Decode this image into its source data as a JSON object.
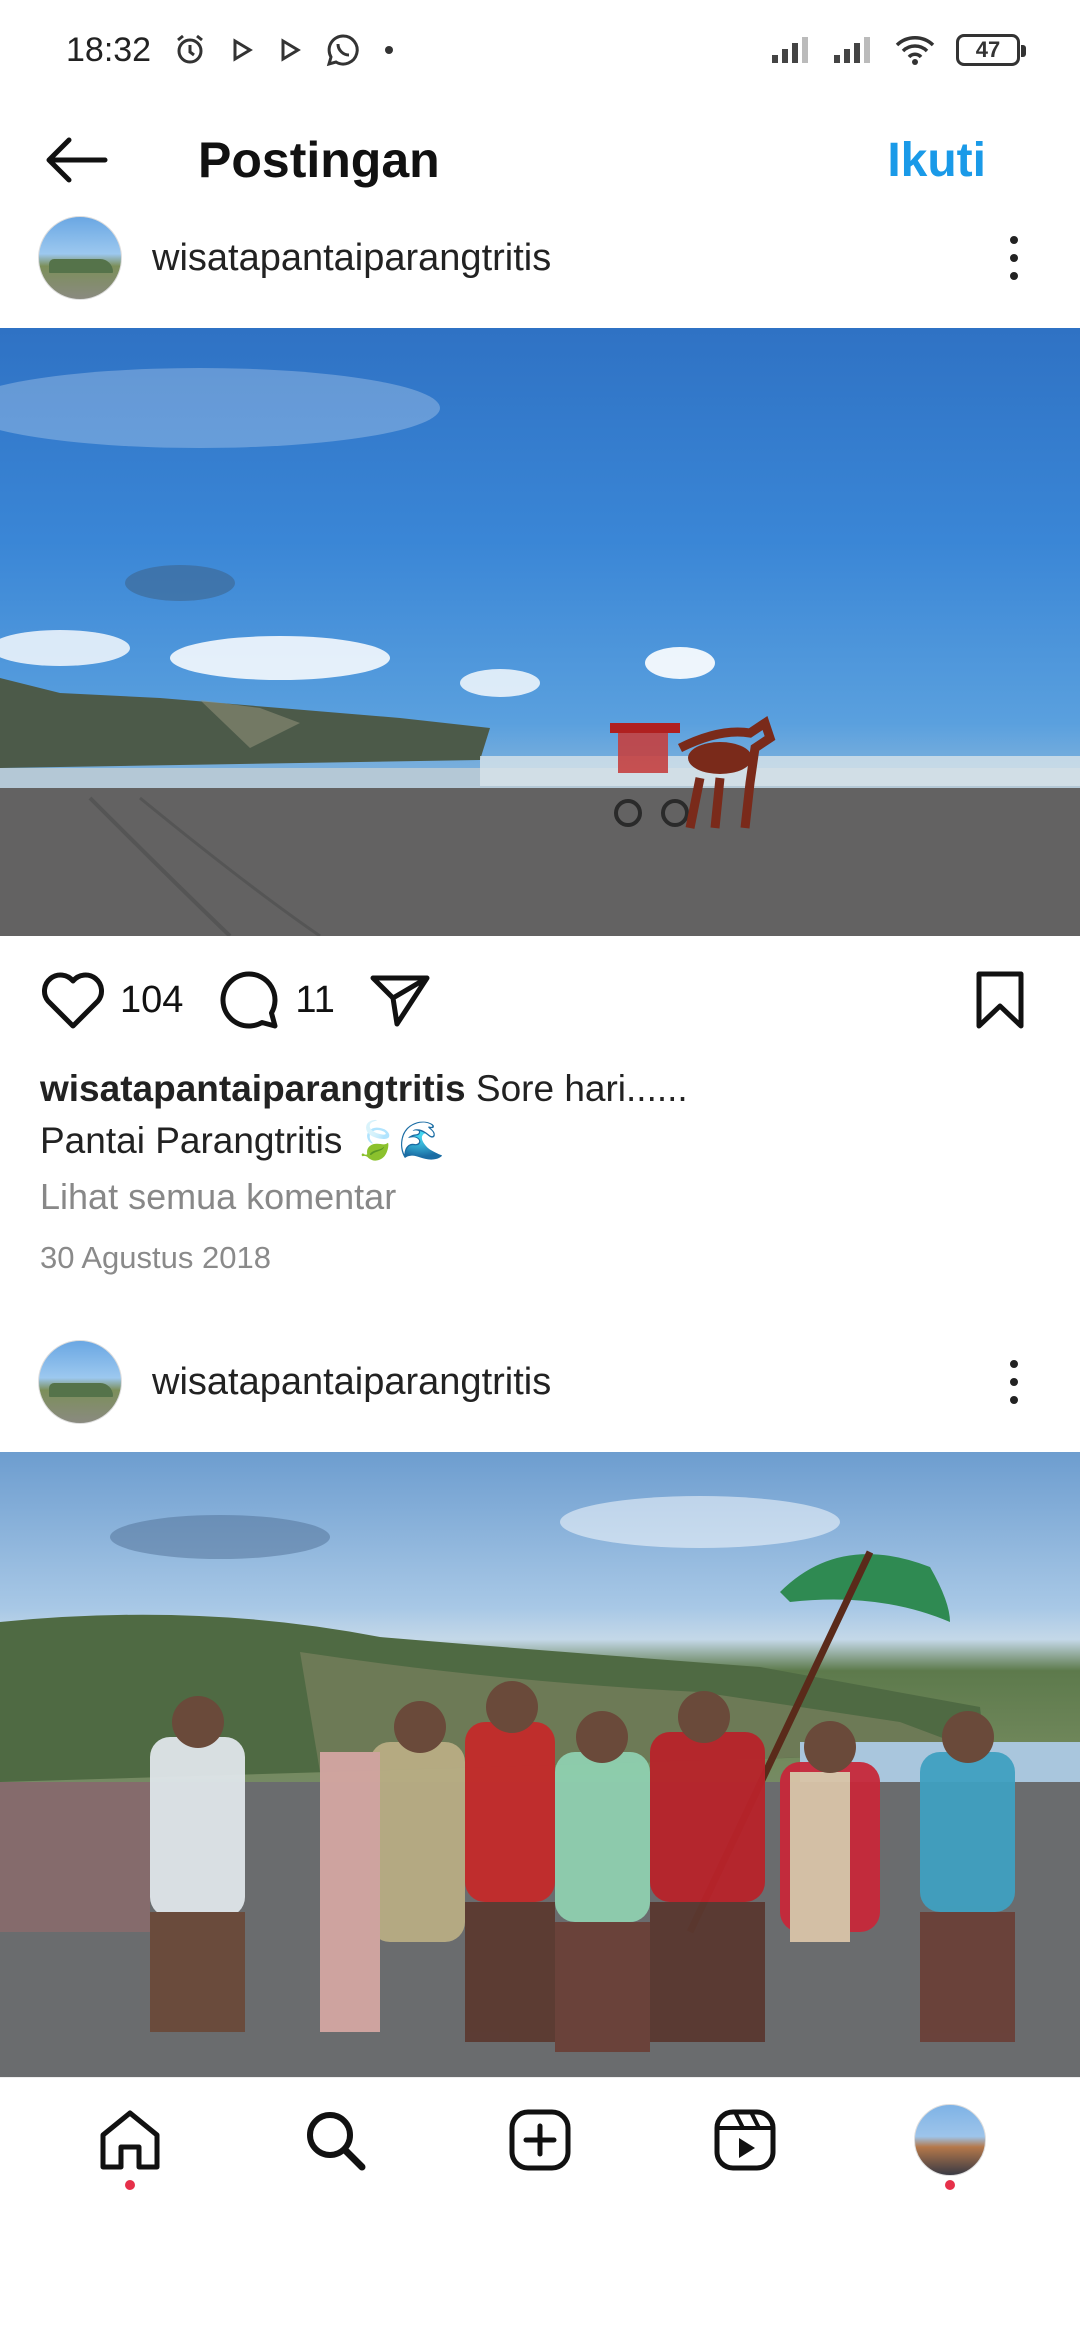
{
  "status_bar": {
    "time": "18:32",
    "battery": "47"
  },
  "header": {
    "title": "Postingan",
    "follow_label": "Ikuti"
  },
  "posts": [
    {
      "username": "wisatapantaiparangtritis",
      "likes": "104",
      "comments": "11",
      "caption_user": "wisatapantaiparangtritis",
      "caption_text": " Sore hari......",
      "caption_line2": "Pantai Parangtritis 🍃🌊",
      "view_comments": "Lihat semua komentar",
      "date": "30 Agustus 2018"
    },
    {
      "username": "wisatapantaiparangtritis"
    }
  ],
  "nav": {
    "items": [
      "home-icon",
      "search-icon",
      "create-icon",
      "reels-icon",
      "profile-avatar"
    ]
  },
  "colors": {
    "accent": "#1a9ae8",
    "notification": "#e6304a"
  }
}
